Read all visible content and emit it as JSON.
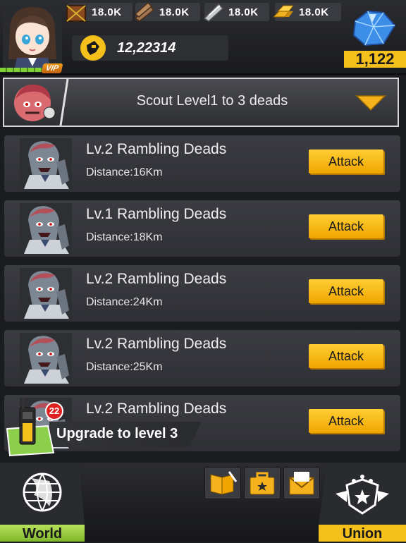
{
  "resources": [
    {
      "icon": "food-crate-icon",
      "value": "18.0K"
    },
    {
      "icon": "wood-icon",
      "value": "18.0K"
    },
    {
      "icon": "steel-icon",
      "value": "18.0K"
    },
    {
      "icon": "gold-icon",
      "value": "18.0K"
    }
  ],
  "power": {
    "icon": "power-fist-icon",
    "value": "12,22314"
  },
  "gems": {
    "icon": "gem-icon",
    "value": "1,122"
  },
  "player": {
    "vip_label": "VIP"
  },
  "scout": {
    "label": "Scout Level1 to 3 deads"
  },
  "targets": [
    {
      "name": "Lv.2 Rambling Deads",
      "distance": "Distance:16Km",
      "action": "Attack"
    },
    {
      "name": "Lv.1 Rambling Deads",
      "distance": "Distance:18Km",
      "action": "Attack"
    },
    {
      "name": "Lv.2 Rambling Deads",
      "distance": "Distance:24Km",
      "action": "Attack"
    },
    {
      "name": "Lv.2 Rambling Deads",
      "distance": "Distance:25Km",
      "action": "Attack"
    },
    {
      "name": "Lv.2 Rambling Deads",
      "distance": "",
      "action": "Attack"
    }
  ],
  "task": {
    "badge": "22",
    "label": "Upgrade to level 3"
  },
  "nav": {
    "world": "World",
    "union": "Union"
  },
  "colors": {
    "accent": "#f5c01c",
    "world": "#8fc63a",
    "badge": "#e02020"
  }
}
